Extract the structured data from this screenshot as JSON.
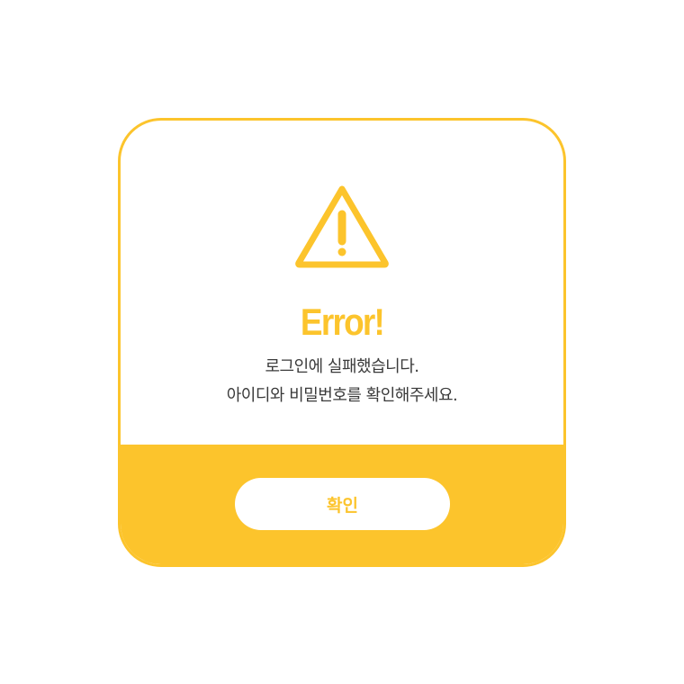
{
  "dialog": {
    "icon": "warning-triangle-icon",
    "title": "Error!",
    "message_line1": "로그인에 실패했습니다.",
    "message_line2": "아이디와 비밀번호를 확인해주세요.",
    "confirm_label": "확인"
  },
  "colors": {
    "accent": "#FCC42C",
    "text": "#3a3a3a",
    "background": "#ffffff"
  }
}
